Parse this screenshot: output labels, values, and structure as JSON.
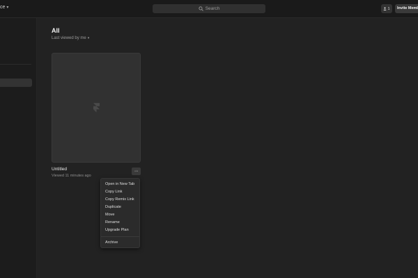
{
  "topbar": {
    "workspace_label": "ce",
    "search_placeholder": "Search",
    "member_count": "1",
    "invite_label": "Invite Members"
  },
  "main": {
    "title": "All",
    "sort_label": "Last viewed by me"
  },
  "file": {
    "name": "Untitled",
    "meta": "Viewed 11 minutes ago",
    "more_label": "···"
  },
  "context_menu": {
    "items": [
      "Open in New Tab",
      "Copy Link",
      "Copy Remix Link",
      "Duplicate",
      "Move",
      "Rename",
      "Upgrade Plan"
    ],
    "footer_item": "Archive"
  },
  "icons": {
    "search": "search-icon",
    "member": "user-icon",
    "chevron": "chevron-down-icon",
    "logo": "framer-logo-icon"
  }
}
